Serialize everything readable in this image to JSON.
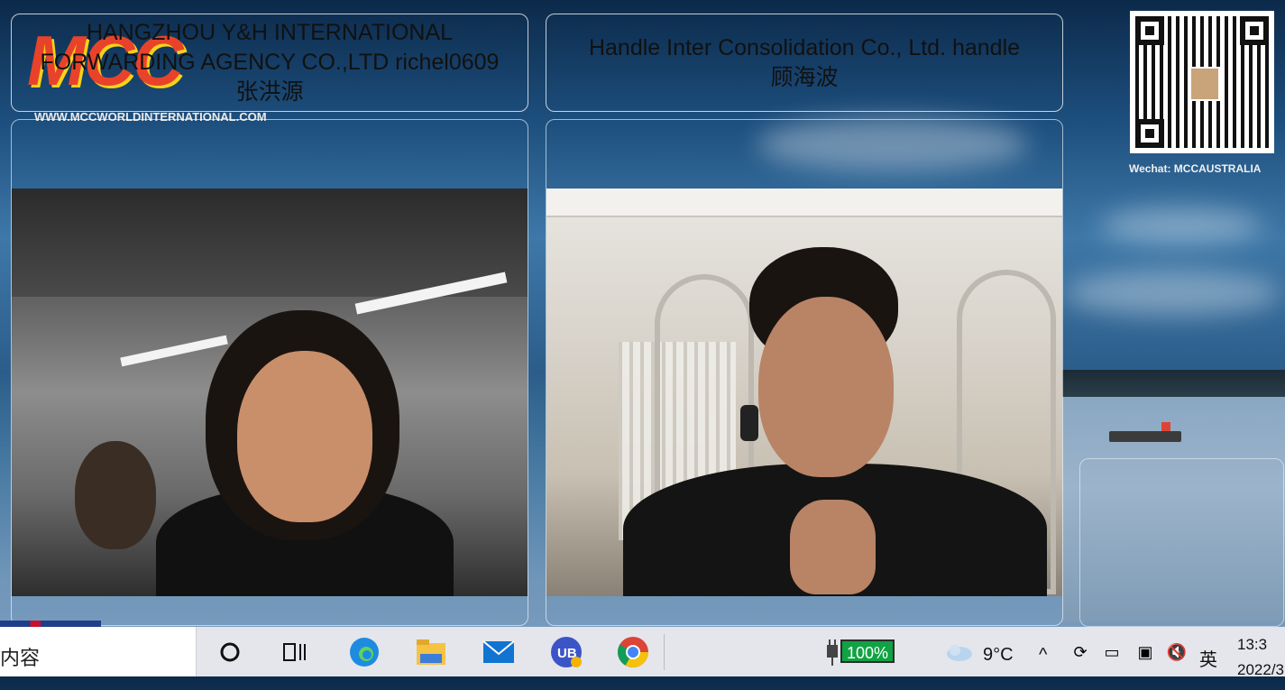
{
  "logo": {
    "brand": "MCC",
    "url": "WWW.MCCWORLDINTERNATIONAL.COM"
  },
  "qr": {
    "caption": "Wechat: MCCAUSTRALIA"
  },
  "participants": [
    {
      "name_line1": "HANGZHOU Y&H INTERNATIONAL",
      "name_line2": "FORWARDING AGENCY CO.,LTD richel0609",
      "name_line3": "张洪源"
    },
    {
      "name_line1": "Handle Inter Consolidation Co., Ltd. handle",
      "name_line2": "顾海波"
    }
  ],
  "taskbar": {
    "search_text": "内容",
    "apps": [
      "task-view",
      "edge",
      "file-explorer",
      "mail",
      "ub-app",
      "chrome"
    ],
    "battery": "100%",
    "weather": "9°C",
    "ime": "英",
    "time": "13:3",
    "date": "2022/3"
  }
}
